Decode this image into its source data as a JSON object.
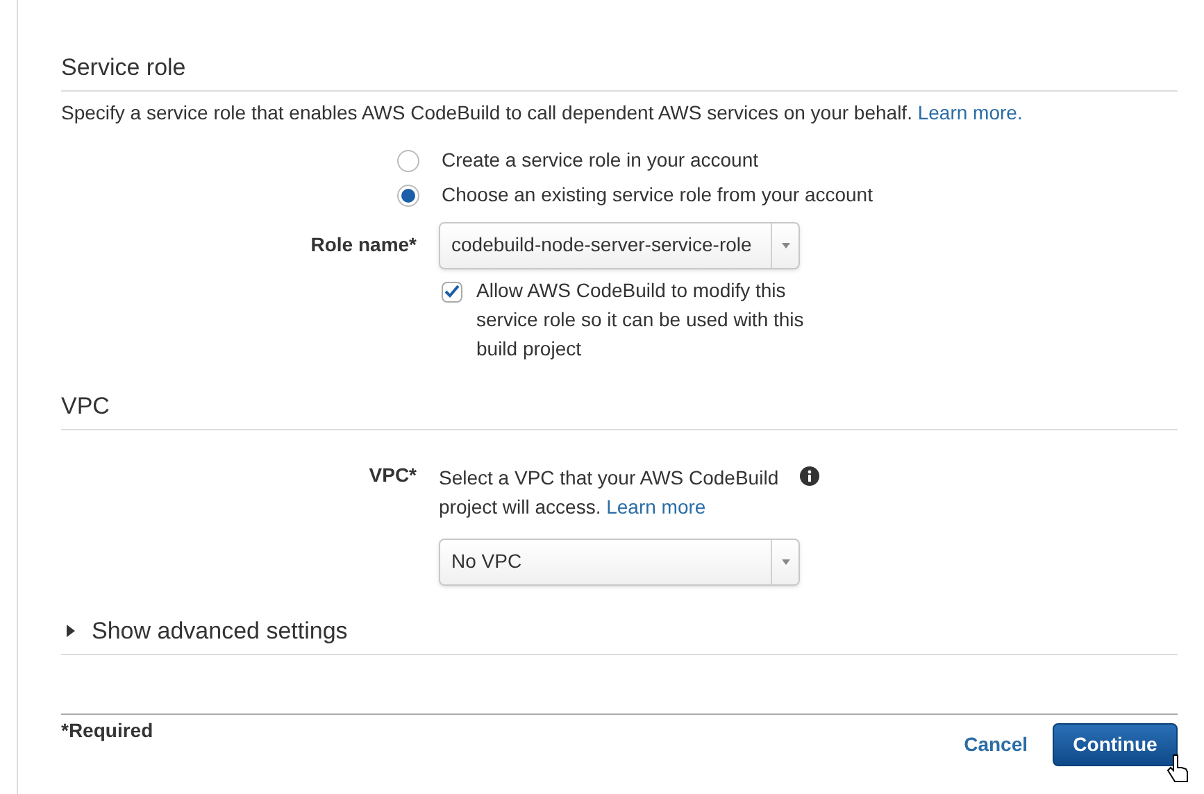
{
  "service_role": {
    "title": "Service role",
    "description": "Specify a service role that enables AWS CodeBuild to call dependent AWS services on your behalf.",
    "learn_more": "Learn more.",
    "options": [
      {
        "label": "Create a service role in your account",
        "selected": false
      },
      {
        "label": "Choose an existing service role from your account",
        "selected": true
      }
    ],
    "role_name": {
      "label": "Role name*",
      "value": "codebuild-node-server-service-role"
    },
    "allow_modify": {
      "label": "Allow AWS CodeBuild to modify this service role so it can be used with this build project",
      "checked": true
    }
  },
  "vpc": {
    "title": "VPC",
    "label": "VPC*",
    "help": "Select a VPC that your AWS CodeBuild project will access.",
    "learn_more": "Learn more",
    "value": "No VPC"
  },
  "advanced": {
    "label": "Show advanced settings",
    "expanded": false
  },
  "footer": {
    "required": "*Required",
    "cancel": "Cancel",
    "continue": "Continue"
  }
}
